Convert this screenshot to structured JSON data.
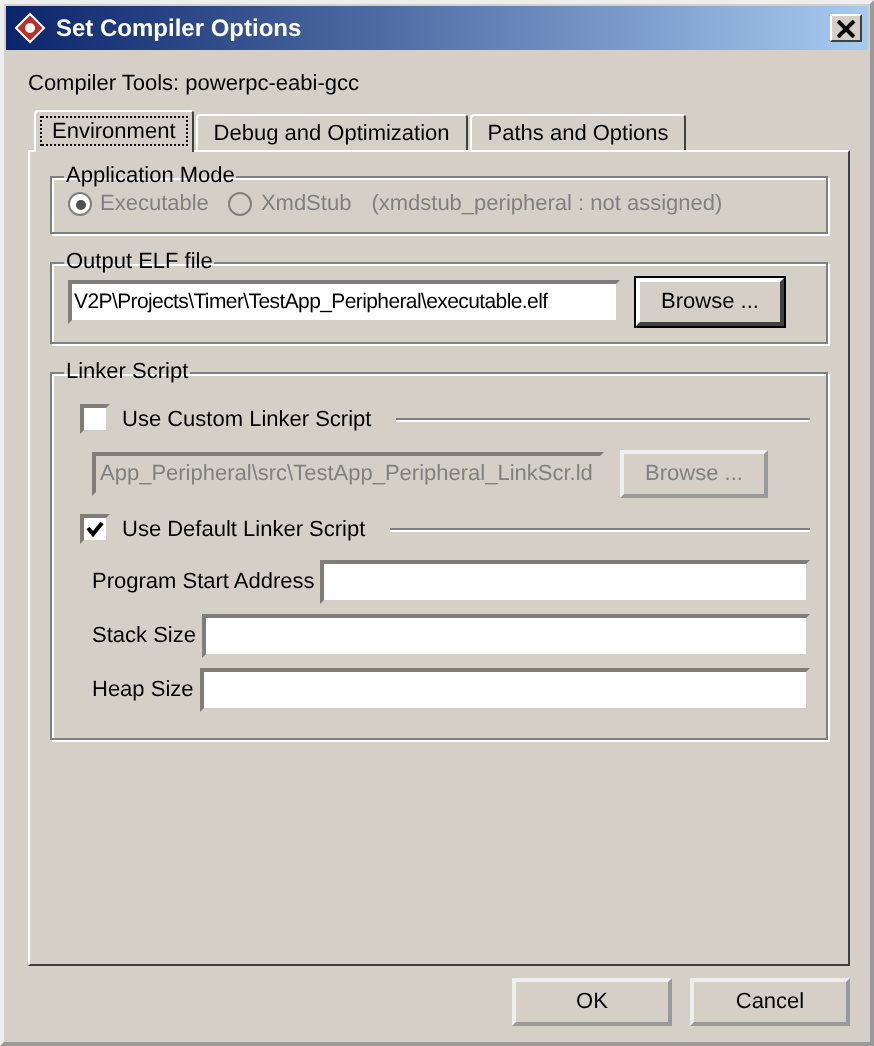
{
  "window": {
    "title": "Set Compiler Options"
  },
  "compiler_tools": "Compiler Tools: powerpc-eabi-gcc",
  "tabs": [
    {
      "label": "Environment",
      "selected": true
    },
    {
      "label": "Debug and Optimization",
      "selected": false
    },
    {
      "label": "Paths and Options",
      "selected": false
    }
  ],
  "application_mode": {
    "title": "Application Mode",
    "disabled": true,
    "options": [
      {
        "label": "Executable",
        "selected": true
      },
      {
        "label": "XmdStub",
        "selected": false
      }
    ],
    "note": "(xmdstub_peripheral : not assigned)"
  },
  "output_elf": {
    "title": "Output ELF file",
    "value": "V2P\\Projects\\Timer\\TestApp_Peripheral\\executable.elf",
    "button": "Browse ..."
  },
  "linker_script": {
    "title": "Linker Script",
    "custom": {
      "label": "Use Custom Linker Script",
      "checked": false,
      "disabled": true,
      "value": "App_Peripheral\\src\\TestApp_Peripheral_LinkScr.ld",
      "button": "Browse ..."
    },
    "default": {
      "label": "Use Default Linker Script",
      "checked": true,
      "fields": [
        {
          "label": "Program Start Address"
        },
        {
          "label": "Stack Size"
        },
        {
          "label": "Heap Size"
        }
      ]
    }
  },
  "buttons": [
    "OK",
    "Cancel"
  ]
}
